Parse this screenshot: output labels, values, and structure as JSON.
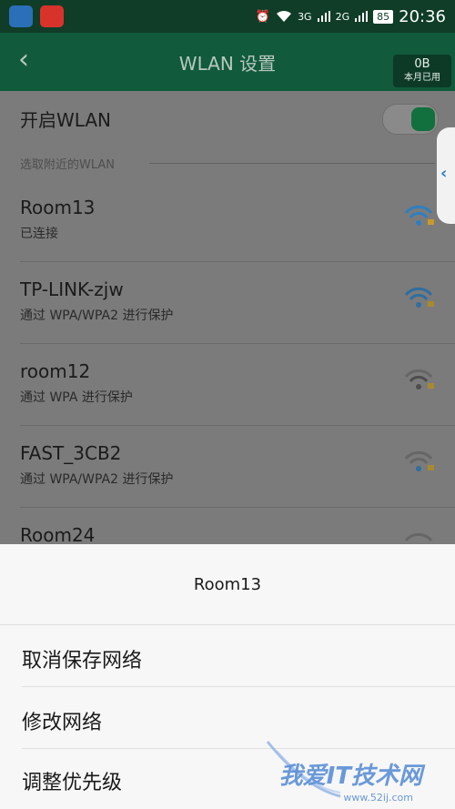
{
  "status_bar": {
    "time": "20:36",
    "battery": "85",
    "signal_1": "3G",
    "signal_2": "2G"
  },
  "header": {
    "title": "WLAN 设置",
    "usage_value": "0B",
    "usage_label": "本月已用"
  },
  "wlan_toggle": {
    "label": "开启WLAN",
    "on": true
  },
  "section_label": "选取附近的WLAN",
  "networks": [
    {
      "name": "Room13",
      "status": "已连接"
    },
    {
      "name": "TP-LINK-zjw",
      "status": "通过 WPA/WPA2 进行保护"
    },
    {
      "name": "room12",
      "status": "通过 WPA 进行保护"
    },
    {
      "name": "FAST_3CB2",
      "status": "通过 WPA/WPA2 进行保护"
    },
    {
      "name": "Room24",
      "status": ""
    }
  ],
  "sheet": {
    "title": "Room13",
    "options": [
      "取消保存网络",
      "修改网络",
      "调整优先级"
    ]
  },
  "watermark": {
    "text": "我爱IT技术网",
    "url": "www.52ij.com"
  },
  "colors": {
    "accent": "#115a3c",
    "wifi_connected": "#2f7fc0"
  }
}
